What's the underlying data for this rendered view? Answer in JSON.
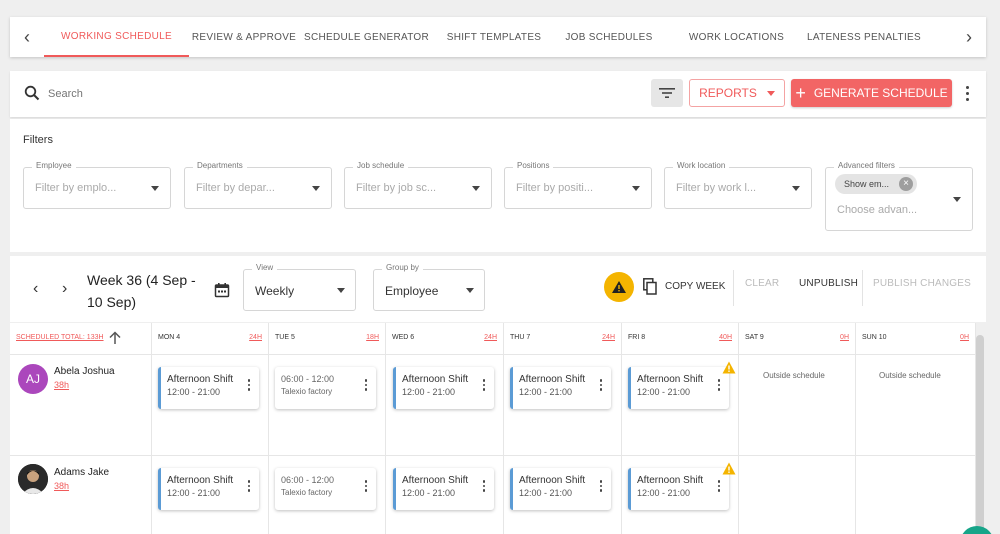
{
  "tabs": {
    "items": [
      {
        "label": "WORKING SCHEDULE",
        "active": true
      },
      {
        "label": "REVIEW & APPROVE",
        "active": false
      },
      {
        "label": "SCHEDULE GENERATOR",
        "active": false
      },
      {
        "label": "SHIFT TEMPLATES",
        "active": false
      },
      {
        "label": "JOB SCHEDULES",
        "active": false
      },
      {
        "label": "WORK LOCATIONS",
        "active": false
      },
      {
        "label": "LATENESS PENALTIES",
        "active": false
      }
    ],
    "prev_icon": "chevron-left-icon",
    "next_icon": "chevron-right-icon"
  },
  "toolbar": {
    "search_placeholder": "Search",
    "reports_label": "REPORTS",
    "generate_label": "GENERATE SCHEDULE",
    "accent_color": "#f26565"
  },
  "filters": {
    "title": "Filters",
    "employee": {
      "label": "Employee",
      "placeholder": "Filter by emplo..."
    },
    "departments": {
      "label": "Departments",
      "placeholder": "Filter by depar..."
    },
    "job_schedule": {
      "label": "Job schedule",
      "placeholder": "Filter by job sc..."
    },
    "positions": {
      "label": "Positions",
      "placeholder": "Filter by positi..."
    },
    "work_location": {
      "label": "Work location",
      "placeholder": "Filter by work l..."
    },
    "advanced": {
      "label": "Advanced filters",
      "chip": "Show em...",
      "placeholder": "Choose advan..."
    }
  },
  "week": {
    "title": "Week 36 (4 Sep - 10 Sep)",
    "view_label": "View",
    "view_value": "Weekly",
    "group_label": "Group by",
    "group_value": "Employee",
    "copy_week": "COPY WEEK",
    "clear": "CLEAR",
    "unpublish": "UNPUBLISH",
    "publish_changes": "PUBLISH CHANGES"
  },
  "grid": {
    "scheduled_total": "SCHEDULED TOTAL: 133H",
    "days": [
      {
        "day": "MON 4",
        "hours": "24H"
      },
      {
        "day": "TUE 5",
        "hours": "18H"
      },
      {
        "day": "WED 6",
        "hours": "24H"
      },
      {
        "day": "THU 7",
        "hours": "24H"
      },
      {
        "day": "FRI 8",
        "hours": "40H"
      },
      {
        "day": "SAT 9",
        "hours": "0H"
      },
      {
        "day": "SUN 10",
        "hours": "0H"
      }
    ],
    "employees": [
      {
        "name": "Abela Joshua",
        "hours": "38h",
        "initials": "AJ",
        "avatar_color": "#ab47bc",
        "shifts": [
          {
            "title": "Afternoon Shift",
            "time": "12:00 - 21:00"
          },
          {
            "title": "06:00 - 12:00",
            "time": "Talexio factory"
          },
          {
            "title": "Afternoon Shift",
            "time": "12:00 - 21:00"
          },
          {
            "title": "Afternoon Shift",
            "time": "12:00 - 21:00"
          },
          {
            "title": "Afternoon Shift",
            "time": "12:00 - 21:00"
          }
        ],
        "outside": [
          "Outside schedule",
          "Outside schedule"
        ]
      },
      {
        "name": "Adams Jake",
        "hours": "38h",
        "shifts": [
          {
            "title": "Afternoon Shift",
            "time": "12:00 - 21:00"
          },
          {
            "title": "06:00 - 12:00",
            "time": "Talexio factory"
          },
          {
            "title": "Afternoon Shift",
            "time": "12:00 - 21:00"
          },
          {
            "title": "Afternoon Shift",
            "time": "12:00 - 21:00"
          },
          {
            "title": "Afternoon Shift",
            "time": "12:00 - 21:00"
          }
        ]
      }
    ]
  }
}
